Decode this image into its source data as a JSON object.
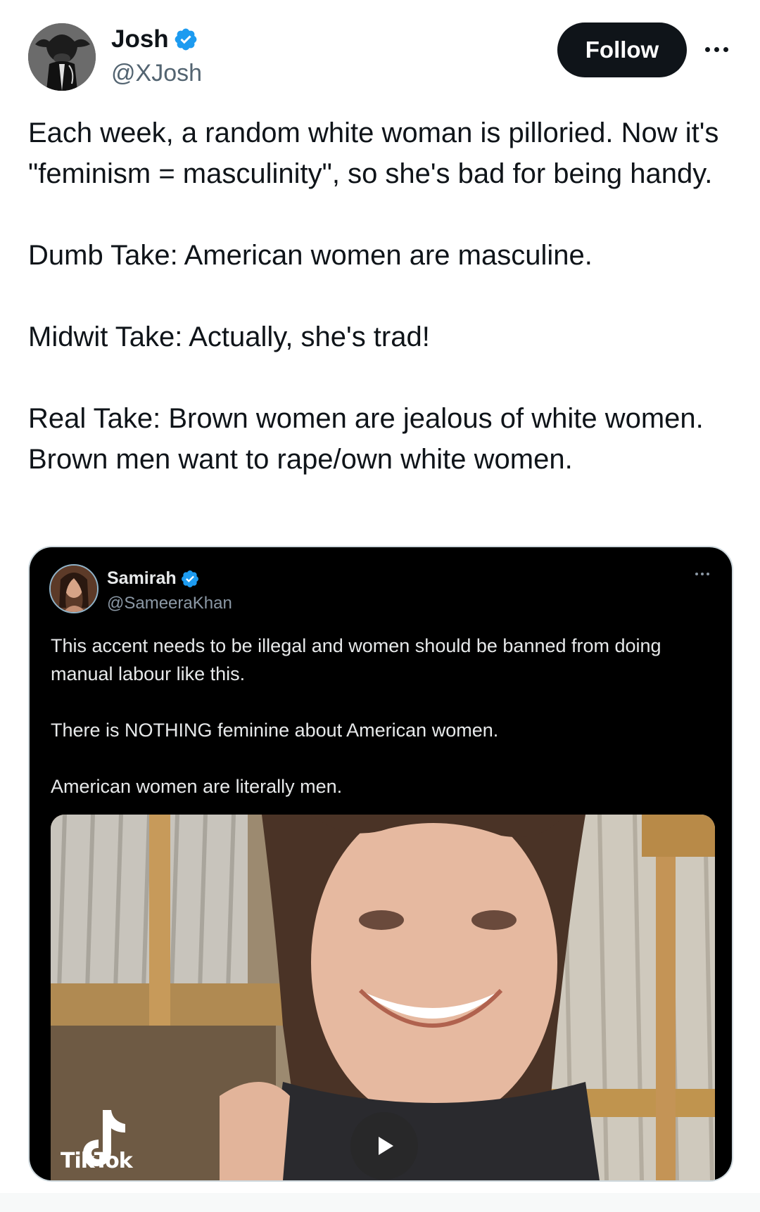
{
  "tweet": {
    "author": {
      "name": "Josh",
      "handle": "@XJosh",
      "verified": true,
      "avatar_icon": "cow-head-person-avatar"
    },
    "follow_label": "Follow",
    "more_icon": "more-horizontal-icon",
    "text": [
      "Each week, a random white woman is pilloried. Now it's \"feminism = masculinity\", so she's bad for being handy.",
      "Dumb Take: American women are masculine.",
      "Midwit Take: Actually, she's trad!",
      "Real Take: Brown women are jealous of white women. Brown men want to rape/own white women."
    ]
  },
  "quoted_tweet": {
    "author": {
      "name": "Samirah",
      "handle": "@SameeraKhan",
      "verified": true
    },
    "more_icon": "more-horizontal-icon",
    "text": [
      "This accent needs to be illegal and women should be banned from doing manual labour like this.",
      "There is NOTHING feminine about American women.",
      "American women are literally men."
    ],
    "media": {
      "type": "video",
      "watermark": "TikTok",
      "play_icon": "play-icon"
    }
  },
  "colors": {
    "verified_blue": "#1d9bf0",
    "follow_bg": "#0f1419",
    "handle_gray": "#536471",
    "quote_bg": "#000000"
  }
}
